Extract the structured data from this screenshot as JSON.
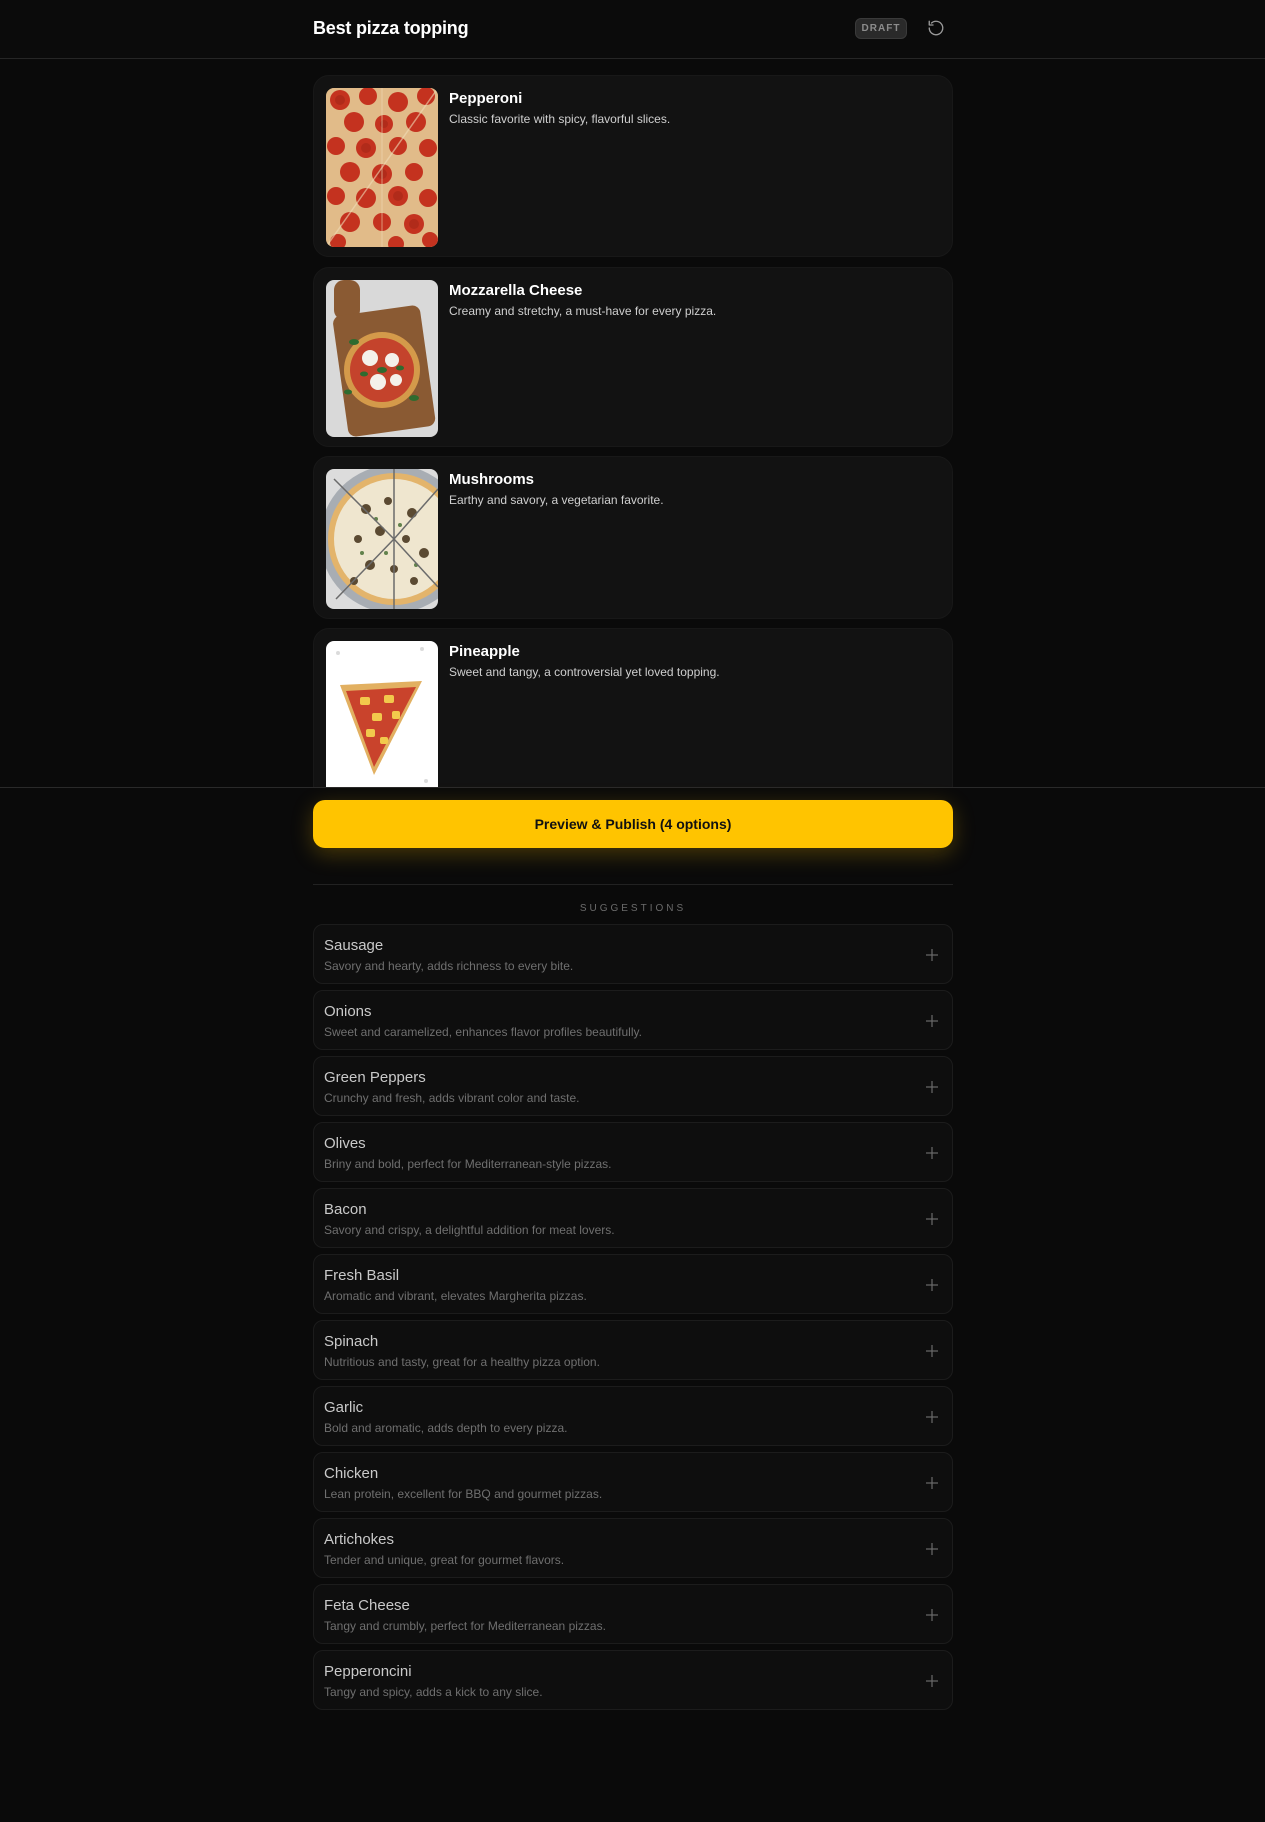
{
  "header": {
    "title": "Best pizza topping",
    "status_badge": "DRAFT",
    "reset_icon": "rotate-ccw-icon"
  },
  "options": [
    {
      "name": "Pepperoni",
      "description": "Classic favorite with spicy, flavorful slices."
    },
    {
      "name": "Mozzarella Cheese",
      "description": "Creamy and stretchy, a must-have for every pizza."
    },
    {
      "name": "Mushrooms",
      "description": "Earthy and savory, a vegetarian favorite."
    },
    {
      "name": "Pineapple",
      "description": "Sweet and tangy, a controversial yet loved topping."
    }
  ],
  "publish": {
    "label": "Preview & Publish (4 options)"
  },
  "suggestions": {
    "title": "SUGGESTIONS",
    "items": [
      {
        "name": "Sausage",
        "description": "Savory and hearty, adds richness to every bite."
      },
      {
        "name": "Onions",
        "description": "Sweet and caramelized, enhances flavor profiles beautifully."
      },
      {
        "name": "Green Peppers",
        "description": "Crunchy and fresh, adds vibrant color and taste."
      },
      {
        "name": "Olives",
        "description": "Briny and bold, perfect for Mediterranean-style pizzas."
      },
      {
        "name": "Bacon",
        "description": "Savory and crispy, a delightful addition for meat lovers."
      },
      {
        "name": "Fresh Basil",
        "description": "Aromatic and vibrant, elevates Margherita pizzas."
      },
      {
        "name": "Spinach",
        "description": "Nutritious and tasty, great for a healthy pizza option."
      },
      {
        "name": "Garlic",
        "description": "Bold and aromatic, adds depth to every pizza."
      },
      {
        "name": "Chicken",
        "description": "Lean protein, excellent for BBQ and gourmet pizzas."
      },
      {
        "name": "Artichokes",
        "description": "Tender and unique, great for gourmet flavors."
      },
      {
        "name": "Feta Cheese",
        "description": "Tangy and crumbly, perfect for Mediterranean pizzas."
      },
      {
        "name": "Pepperoncini",
        "description": "Tangy and spicy, adds a kick to any slice."
      }
    ]
  },
  "colors": {
    "background": "#0a0a0a",
    "card": "#121212",
    "accent": "#ffc400"
  }
}
